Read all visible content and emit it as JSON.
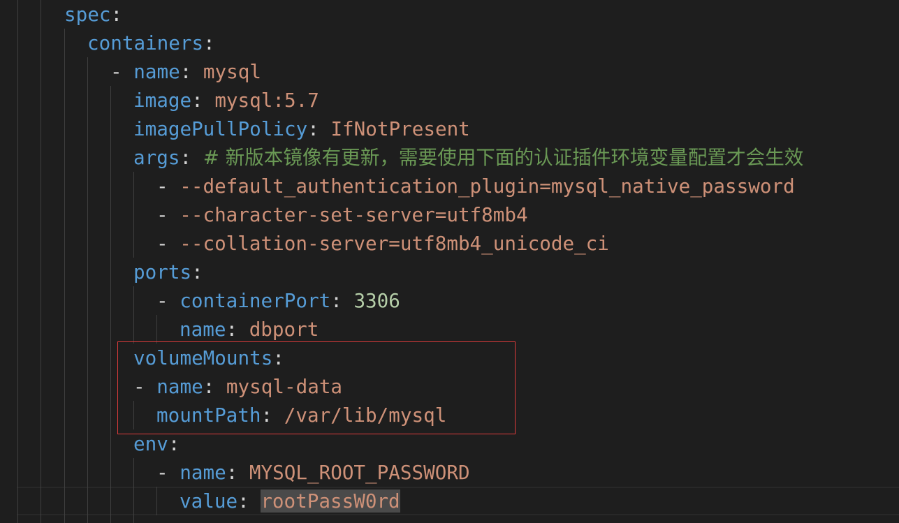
{
  "editor": {
    "theme": {
      "key": "#569cd6",
      "string": "#ce9178",
      "number": "#b5cea8",
      "comment": "#6a9955",
      "annotation": "#e03c3c"
    },
    "lines": {
      "l1": {
        "key": "spec",
        "sep": ":"
      },
      "l2": {
        "key": "containers",
        "sep": ":"
      },
      "l3": {
        "dash": "- ",
        "key": "name",
        "sep": ": ",
        "value": "mysql"
      },
      "l4": {
        "key": "image",
        "sep": ": ",
        "value": "mysql:5.7"
      },
      "l5": {
        "key": "imagePullPolicy",
        "sep": ": ",
        "value": "IfNotPresent"
      },
      "l6": {
        "key": "args",
        "sep": ": ",
        "comment": "# 新版本镜像有更新，需要使用下面的认证插件环境变量配置才会生效"
      },
      "l7": {
        "dash": "- ",
        "value": "--default_authentication_plugin=mysql_native_password"
      },
      "l8": {
        "dash": "- ",
        "value": "--character-set-server=utf8mb4"
      },
      "l9": {
        "dash": "- ",
        "value": "--collation-server=utf8mb4_unicode_ci"
      },
      "l10": {
        "key": "ports",
        "sep": ":"
      },
      "l11": {
        "dash": "- ",
        "key": "containerPort",
        "sep": ": ",
        "value": "3306"
      },
      "l12": {
        "key": "name",
        "sep": ": ",
        "value": "dbport"
      },
      "l13": {
        "key": "volumeMounts",
        "sep": ":"
      },
      "l14": {
        "dash": "- ",
        "key": "name",
        "sep": ": ",
        "value": "mysql-data"
      },
      "l15": {
        "key": "mountPath",
        "sep": ": ",
        "value": "/var/lib/mysql"
      },
      "l16": {
        "key": "env",
        "sep": ":"
      },
      "l17": {
        "dash": "- ",
        "key": "name",
        "sep": ": ",
        "value": "MYSQL_ROOT_PASSWORD"
      },
      "l18": {
        "key": "value",
        "sep": ": ",
        "value": "rootPassW0rd"
      }
    }
  }
}
